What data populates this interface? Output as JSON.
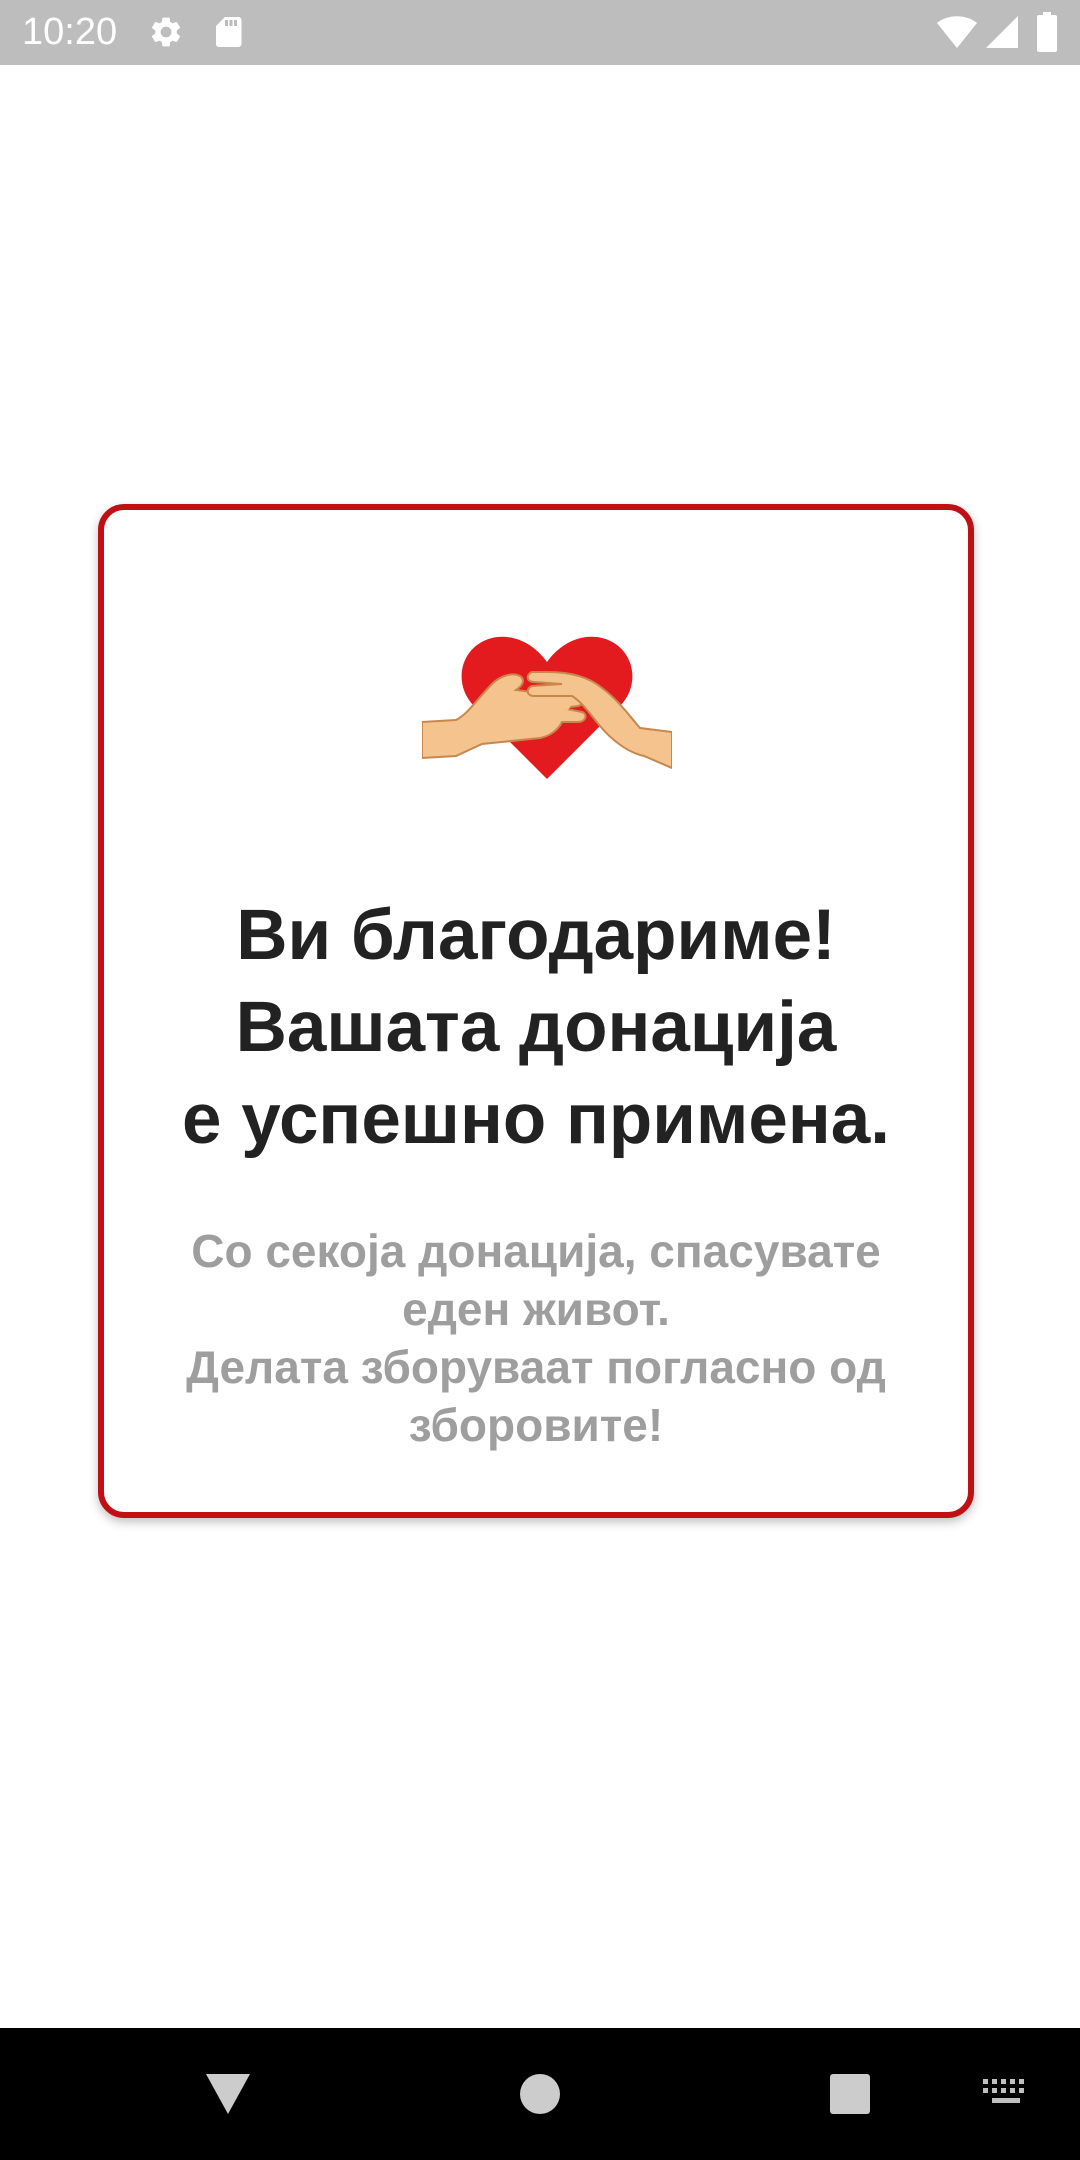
{
  "status_bar": {
    "time": "10:20",
    "icons": [
      "gear-icon",
      "sd-card-icon",
      "wifi-icon",
      "signal-icon",
      "battery-icon"
    ]
  },
  "card": {
    "border_color": "#c01015",
    "illustration": "heart-hands-icon",
    "title_lines": [
      "Ви благодариме!",
      "Вашата донација",
      "е успешно примена."
    ],
    "subtitle_lines": [
      "Со секоја донација, спасувате",
      "еден живот.",
      "Делата зборуваат погласно од",
      "зборовите!"
    ]
  },
  "nav_bar": {
    "buttons": [
      "back-icon",
      "home-icon",
      "recents-icon",
      "keyboard-icon"
    ]
  }
}
